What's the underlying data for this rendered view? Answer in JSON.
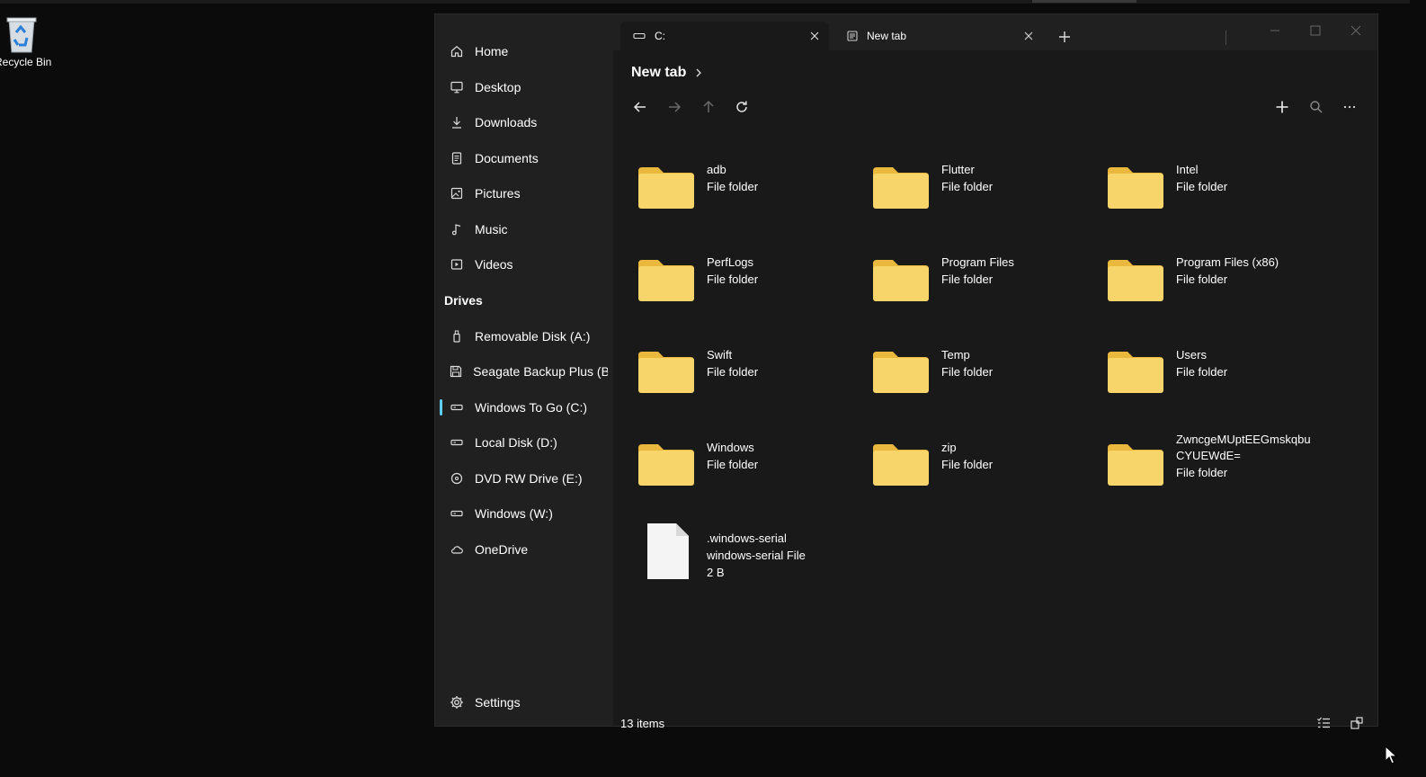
{
  "desktop": {
    "recycle_bin_label": "Recycle Bin"
  },
  "sidebar": {
    "items": [
      {
        "label": "Home",
        "icon": "home-icon"
      },
      {
        "label": "Desktop",
        "icon": "desktop-icon"
      },
      {
        "label": "Downloads",
        "icon": "download-icon"
      },
      {
        "label": "Documents",
        "icon": "document-icon"
      },
      {
        "label": "Pictures",
        "icon": "picture-icon"
      },
      {
        "label": "Music",
        "icon": "music-icon"
      },
      {
        "label": "Videos",
        "icon": "video-icon"
      }
    ],
    "drives_heading": "Drives",
    "drives": [
      {
        "label": "Removable Disk (A:)",
        "icon": "usb-icon"
      },
      {
        "label": "Seagate Backup Plus (B:)",
        "icon": "save-drive-icon"
      },
      {
        "label": "Windows To Go (C:)",
        "icon": "drive-icon",
        "active": true
      },
      {
        "label": "Local Disk (D:)",
        "icon": "drive-icon"
      },
      {
        "label": "DVD RW Drive (E:)",
        "icon": "disc-icon"
      },
      {
        "label": "Windows (W:)",
        "icon": "drive-icon"
      },
      {
        "label": "OneDrive",
        "icon": "cloud-icon"
      }
    ],
    "settings_label": "Settings"
  },
  "tabs": [
    {
      "label": "C:",
      "icon": "drive-icon",
      "active": true
    },
    {
      "label": "New tab",
      "icon": "newtab-icon",
      "active": false
    }
  ],
  "breadcrumb": {
    "label": "New tab"
  },
  "items": [
    {
      "name": "adb",
      "type": "File folder",
      "kind": "folder"
    },
    {
      "name": "Flutter",
      "type": "File folder",
      "kind": "folder"
    },
    {
      "name": "Intel",
      "type": "File folder",
      "kind": "folder"
    },
    {
      "name": "PerfLogs",
      "type": "File folder",
      "kind": "folder"
    },
    {
      "name": "Program Files",
      "type": "File folder",
      "kind": "folder"
    },
    {
      "name": "Program Files (x86)",
      "type": "File folder",
      "kind": "folder"
    },
    {
      "name": "Swift",
      "type": "File folder",
      "kind": "folder"
    },
    {
      "name": "Temp",
      "type": "File folder",
      "kind": "folder"
    },
    {
      "name": "Users",
      "type": "File folder",
      "kind": "folder"
    },
    {
      "name": "Windows",
      "type": "File folder",
      "kind": "folder"
    },
    {
      "name": "zip",
      "type": "File folder",
      "kind": "folder"
    },
    {
      "name": "ZwncgeMUptEEGmskqbuCYUEWdE=",
      "name_line1": "ZwncgeMUptEEGmskqbu",
      "name_line2": "CYUEWdE=",
      "type": "File folder",
      "kind": "folder"
    },
    {
      "name": ".windows-serial",
      "type": "windows-serial File",
      "size": "2 B",
      "kind": "file"
    }
  ],
  "status": {
    "count_text": "13 items"
  },
  "colors": {
    "folder": "#f8d56a",
    "folder_tab": "#e9b83c",
    "accent": "#60cdff",
    "window_bg": "#191919",
    "sidebar_bg": "#202020"
  }
}
